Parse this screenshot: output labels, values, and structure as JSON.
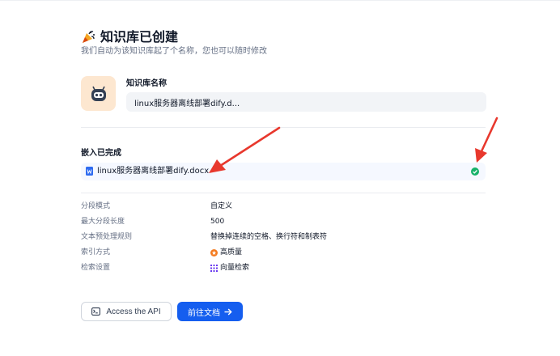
{
  "header": {
    "title": "知识库已创建",
    "subtitle": "我们自动为该知识库起了个名称，您也可以随时修改"
  },
  "dataset": {
    "name_label": "知识库名称",
    "name_value": "linux服务器离线部署dify.d..."
  },
  "embedding": {
    "title": "嵌入已完成",
    "file_name": "linux服务器离线部署dify.docx"
  },
  "settings": [
    {
      "label": "分段模式",
      "value": "自定义"
    },
    {
      "label": "最大分段长度",
      "value": "500"
    },
    {
      "label": "文本预处理规则",
      "value": "替换掉连续的空格、换行符和制表符"
    },
    {
      "label": "索引方式",
      "value": "高质量",
      "icon": "quality-icon"
    },
    {
      "label": "检索设置",
      "value": "向量检索",
      "icon": "vector-grid-icon"
    }
  ],
  "actions": {
    "api_label": "Access the API",
    "doc_label": "前往文档"
  },
  "colors": {
    "primary": "#155eef",
    "success": "#17b26a",
    "annotation": "#e8382d",
    "input_bg": "#f2f4f7",
    "file_row_bg": "#f5f8ff"
  }
}
